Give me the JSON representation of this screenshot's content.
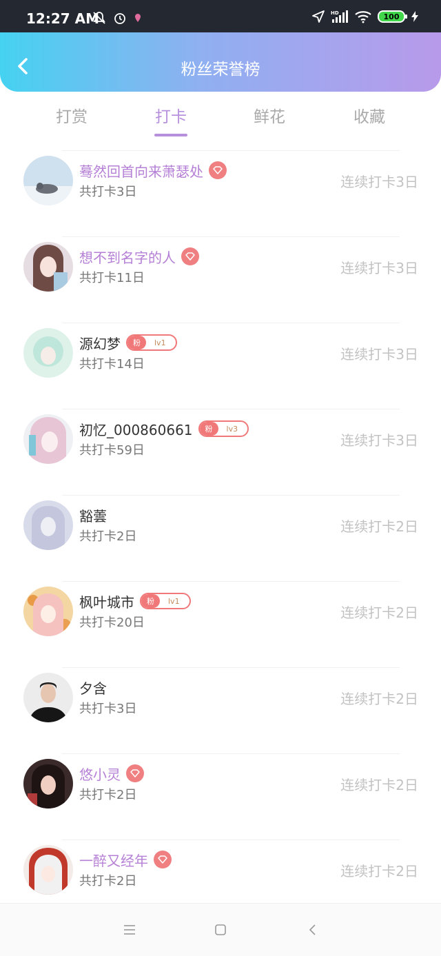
{
  "status_bar": {
    "time": "12:27 AM",
    "battery": "100",
    "network": "HD"
  },
  "header": {
    "title": "粉丝荣誉榜"
  },
  "tabs": [
    {
      "label": "打赏"
    },
    {
      "label": "打卡"
    },
    {
      "label": "鲜花"
    },
    {
      "label": "收藏"
    }
  ],
  "active_tab": "打卡",
  "fan_badge_label": "粉",
  "items": [
    {
      "name": "蓦然回首向来萧瑟处",
      "total": "共打卡3日",
      "streak": "连续打卡3日",
      "badge": "gem"
    },
    {
      "name": "想不到名字的人",
      "total": "共打卡11日",
      "streak": "连续打卡3日",
      "badge": "gem"
    },
    {
      "name": "源幻梦",
      "total": "共打卡14日",
      "streak": "连续打卡3日",
      "badge": "fan",
      "level": "lv1"
    },
    {
      "name": "初忆_000860661",
      "total": "共打卡59日",
      "streak": "连续打卡3日",
      "badge": "fan",
      "level": "lv3"
    },
    {
      "name": "豁蕓",
      "total": "共打卡2日",
      "streak": "连续打卡2日",
      "badge": "none"
    },
    {
      "name": "枫叶城市",
      "total": "共打卡20日",
      "streak": "连续打卡2日",
      "badge": "fan",
      "level": "lv1"
    },
    {
      "name": "夕含",
      "total": "共打卡3日",
      "streak": "连续打卡2日",
      "badge": "none"
    },
    {
      "name": "悠小灵",
      "total": "共打卡2日",
      "streak": "连续打卡2日",
      "badge": "gem"
    },
    {
      "name": "一醉又经年",
      "total": "共打卡2日",
      "streak": "连续打卡2日",
      "badge": "gem"
    }
  ],
  "icons": {
    "back": "back-chevron-icon",
    "gem": "diamond-icon",
    "nav_menu": "menu-icon",
    "nav_home": "home-square-icon",
    "nav_back": "back-icon"
  },
  "colors": {
    "gradient_start": "#45d2f1",
    "gradient_end": "#b89aea",
    "accent": "#b790dd",
    "vip_name": "#b57fd6",
    "badge_red": "#ef7f80"
  }
}
